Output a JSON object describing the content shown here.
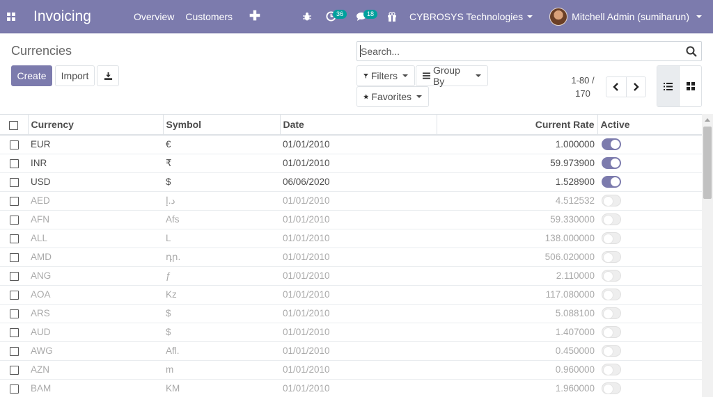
{
  "navbar": {
    "brand": "Invoicing",
    "menu": [
      "Overview",
      "Customers"
    ],
    "plus": "✚",
    "activity_count": "36",
    "messages_count": "18",
    "company": "CYBROSYS Technologies",
    "user": "Mitchell Admin (sumiharun)"
  },
  "control": {
    "breadcrumb": "Currencies",
    "create_label": "Create",
    "import_label": "Import",
    "search_placeholder": "Search...",
    "filters_label": "Filters",
    "groupby_label": "Group By",
    "favorites_label": "Favorites",
    "pager_range": "1-80 /",
    "pager_total": "170"
  },
  "table": {
    "headers": {
      "currency": "Currency",
      "symbol": "Symbol",
      "date": "Date",
      "rate": "Current Rate",
      "active": "Active"
    },
    "rows": [
      {
        "currency": "EUR",
        "symbol": "€",
        "date": "01/01/2010",
        "rate": "1.000000",
        "active": true
      },
      {
        "currency": "INR",
        "symbol": "₹",
        "date": "01/01/2010",
        "rate": "59.973900",
        "active": true
      },
      {
        "currency": "USD",
        "symbol": "$",
        "date": "06/06/2020",
        "rate": "1.528900",
        "active": true
      },
      {
        "currency": "AED",
        "symbol": "د.إ",
        "date": "01/01/2010",
        "rate": "4.512532",
        "active": false
      },
      {
        "currency": "AFN",
        "symbol": "Afs",
        "date": "01/01/2010",
        "rate": "59.330000",
        "active": false
      },
      {
        "currency": "ALL",
        "symbol": "L",
        "date": "01/01/2010",
        "rate": "138.000000",
        "active": false
      },
      {
        "currency": "AMD",
        "symbol": "դր.",
        "date": "01/01/2010",
        "rate": "506.020000",
        "active": false
      },
      {
        "currency": "ANG",
        "symbol": "ƒ",
        "date": "01/01/2010",
        "rate": "2.110000",
        "active": false
      },
      {
        "currency": "AOA",
        "symbol": "Kz",
        "date": "01/01/2010",
        "rate": "117.080000",
        "active": false
      },
      {
        "currency": "ARS",
        "symbol": "$",
        "date": "01/01/2010",
        "rate": "5.088100",
        "active": false
      },
      {
        "currency": "AUD",
        "symbol": "$",
        "date": "01/01/2010",
        "rate": "1.407000",
        "active": false
      },
      {
        "currency": "AWG",
        "symbol": "Afl.",
        "date": "01/01/2010",
        "rate": "0.450000",
        "active": false
      },
      {
        "currency": "AZN",
        "symbol": "m",
        "date": "01/01/2010",
        "rate": "0.960000",
        "active": false
      },
      {
        "currency": "BAM",
        "symbol": "KM",
        "date": "01/01/2010",
        "rate": "1.960000",
        "active": false
      }
    ]
  },
  "colors": {
    "brand": "#7c7bad",
    "badge": "#00a09d"
  }
}
